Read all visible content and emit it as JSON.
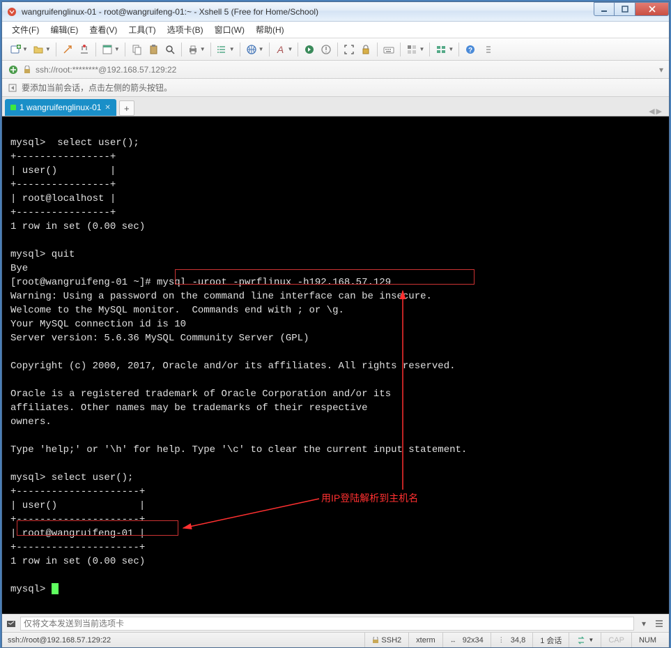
{
  "window": {
    "title": "wangruifenglinux-01 - root@wangruifeng-01:~ - Xshell 5 (Free for Home/School)"
  },
  "menus": {
    "file": "文件(F)",
    "edit": "编辑(E)",
    "view": "查看(V)",
    "tools": "工具(T)",
    "tabs": "选项卡(B)",
    "window": "窗口(W)",
    "help": "帮助(H)"
  },
  "address": {
    "text": "ssh://root:********@192.168.57.129:22"
  },
  "hint": {
    "text": "要添加当前会话，点击左侧的箭头按钮。"
  },
  "tab": {
    "label": "1 wangruifenglinux-01"
  },
  "terminal": {
    "lines": "\nmysql>  select user();\n+----------------+\n| user()         |\n+----------------+\n| root@localhost |\n+----------------+\n1 row in set (0.00 sec)\n\nmysql> quit\nBye\n[root@wangruifeng-01 ~]# mysql -uroot -pwrflinux -h192.168.57.129\nWarning: Using a password on the command line interface can be insecure.\nWelcome to the MySQL monitor.  Commands end with ; or \\g.\nYour MySQL connection id is 10\nServer version: 5.6.36 MySQL Community Server (GPL)\n\nCopyright (c) 2000, 2017, Oracle and/or its affiliates. All rights reserved.\n\nOracle is a registered trademark of Oracle Corporation and/or its\naffiliates. Other names may be trademarks of their respective\nowners.\n\nType 'help;' or '\\h' for help. Type '\\c' to clear the current input statement.\n\nmysql> select user();\n+---------------------+\n| user()              |\n+---------------------+\n| root@wangruifeng-01 |\n+---------------------+\n1 row in set (0.00 sec)\n\nmysql> "
  },
  "annotation": {
    "text": "用IP登陆解析到主机名"
  },
  "bottom": {
    "placeholder": "仅将文本发送到当前选项卡"
  },
  "status": {
    "connection": "ssh://root@192.168.57.129:22",
    "ssh": "SSH2",
    "term": "xterm",
    "size": "92x34",
    "pos": "34,8",
    "sessions": "1 会话",
    "cap": "CAP",
    "num": "NUM"
  }
}
